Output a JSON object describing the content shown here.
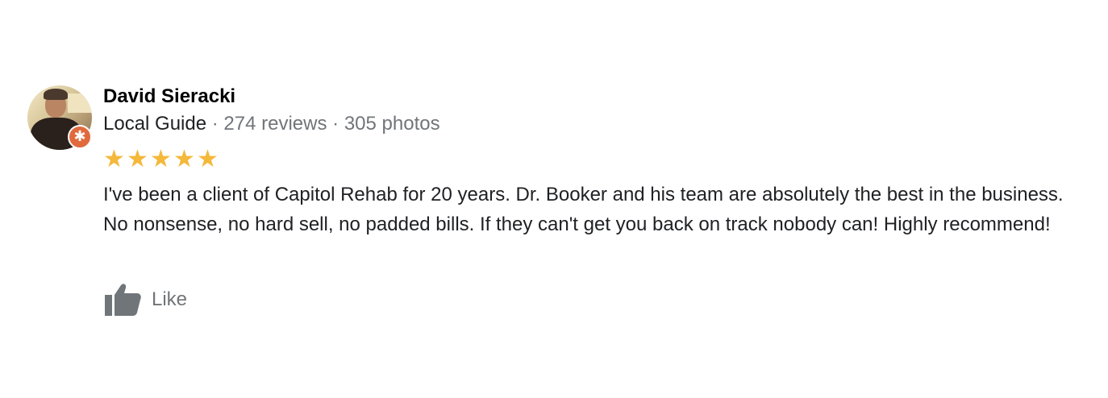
{
  "reviewer": {
    "name": "David Sieracki",
    "badge": "Local Guide",
    "reviews": "274 reviews",
    "photos": "305 photos",
    "separator": " · "
  },
  "rating": {
    "value": 5,
    "max": 5,
    "star_glyph": "★",
    "color": "#f4b83a"
  },
  "review": {
    "text": "I've been a client of Capitol Rehab for 20 years. Dr. Booker and his team are absolutely the best in the business. No nonsense, no hard sell, no padded bills. If they can't get you back on track nobody can! Highly recommend!"
  },
  "actions": {
    "like_label": "Like",
    "like_icon": "thumbs-up-icon"
  },
  "colors": {
    "secondary_text": "#70757a",
    "primary_text": "#202124",
    "local_guide_badge": "#e06a3c"
  }
}
